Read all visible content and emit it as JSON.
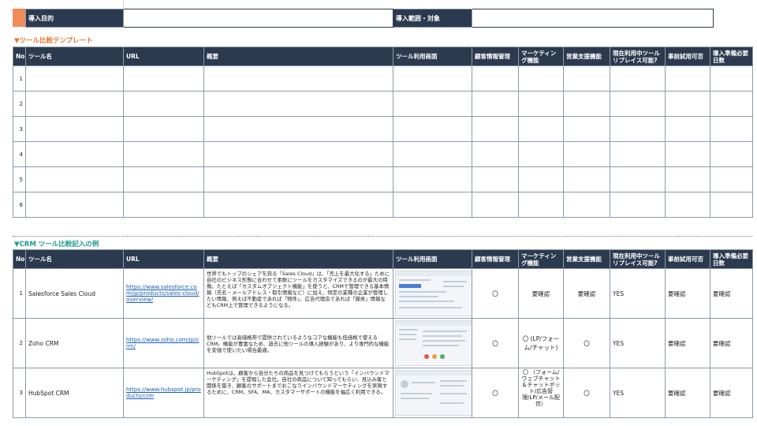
{
  "header": {
    "purpose_label": "導入目的",
    "scope_label": "導入範囲・対象"
  },
  "template_section": {
    "title": "▼ツール比較テンプレート",
    "rows": [
      "1",
      "2",
      "3",
      "4",
      "5",
      "6"
    ]
  },
  "columns": {
    "no": "No",
    "tool": "ツール名",
    "url": "URL",
    "summary": "概要",
    "screen": "ツール利用画面",
    "customer": "顧客情報管理",
    "marketing": "マーケティング機能",
    "sales": "営業支援機能",
    "replace": "現在利用中ツールリプレイス可能?",
    "trial": "事前試用可否",
    "days": "導入準備必要日数"
  },
  "example_section": {
    "title": "▼CRM ツール比較記入の例",
    "rows": [
      {
        "no": "1",
        "tool": "Salesforce Sales Cloud",
        "url": "https://www.salesforce.com/jp/products/sales-cloud/overview/",
        "summary": "世界でもトップのシェアを誇る「Sales Cloud」は、「売上を最大化する」ために自社のビジネス形態に合わせて柔軟にツールをカスタマイズできるのが最大の特徴。たとえば「カスタムオブジェクト機能」を使うと、CRMで管理できる基本情報（氏名・メールアドレス・取引情報など）に加え、特定の業種の企業が管理したい情報、例えば不動産であれば「物件」、広告代理店であれば「媒体」情報などもCRM上で管理できるようになる。",
        "customer": "〇",
        "marketing": "要確認",
        "sales": "要確認",
        "replace": "YES",
        "trial": "要確認",
        "days": "要確認"
      },
      {
        "no": "2",
        "tool": "Zoho CRM",
        "url": "https://www.zoho.com/jp/crm/",
        "summary": "他ツールでは高価格帯で提供されているようなコアな機能も低価格で使えるCRM。機能が豊富なため、過去に他ツールの導入経験があり、より専門的な機能を安価で使いたい場合最適。",
        "customer": "〇",
        "marketing": "〇 (LP/フォーム/チャット)",
        "sales": "〇",
        "replace": "YES",
        "trial": "要確認",
        "days": "要確認"
      },
      {
        "no": "3",
        "tool": "HubSpot CRM",
        "url": "https://www.hubspot.jp/products/crm",
        "summary": "HubSpotは、顧客から自分たちの商品を見つけてもらうという「インバウンドマーケティング」を提唱した会社。自社の商品について知ってもらい、見込み客と関係を築き、顧客のサポートまでおこなうインバウンドマーケティングを実現するために、CRM、SFA、MA、カスタマーサポートの機能を幅広く利用できる。",
        "customer": "〇",
        "marketing": "〇 （フォーム/ウェブチャット＆チャットボット/広告管理/LP/メール配信）",
        "sales": "〇",
        "replace": "YES",
        "trial": "要確認",
        "days": "要確認"
      }
    ]
  },
  "colors": {
    "header_bg": "#2b3a4f",
    "accent_orange": "#f28b5a",
    "section_orange": "#e8762d",
    "section_teal": "#1a9a8e",
    "link": "#1a5fb4"
  }
}
